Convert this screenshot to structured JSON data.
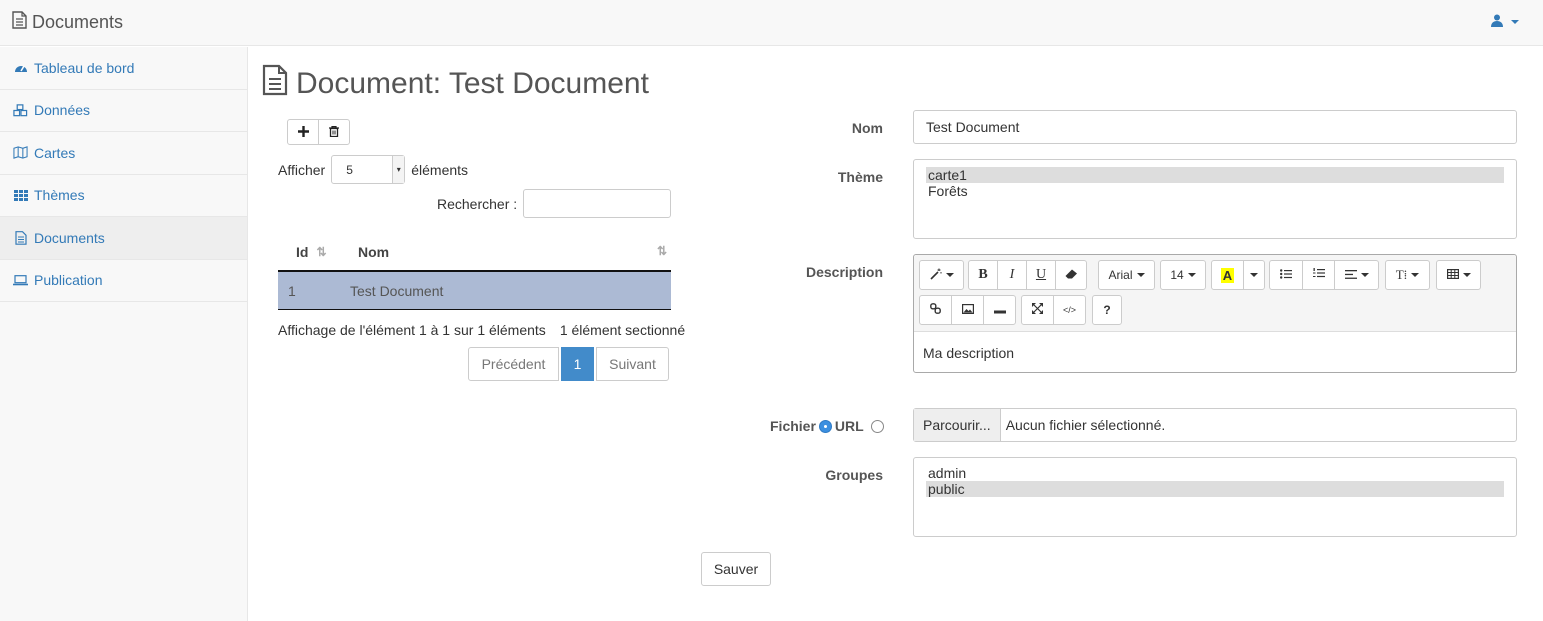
{
  "app": {
    "title": "Documents"
  },
  "sidebar": {
    "items": [
      {
        "label": "Tableau de bord",
        "icon": "dashboard-icon"
      },
      {
        "label": "Données",
        "icon": "cubes-icon"
      },
      {
        "label": "Cartes",
        "icon": "map-icon"
      },
      {
        "label": "Thèmes",
        "icon": "grid-icon"
      },
      {
        "label": "Documents",
        "icon": "document-icon",
        "active": true
      },
      {
        "label": "Publication",
        "icon": "laptop-icon"
      }
    ]
  },
  "page": {
    "title": "Document: Test Document"
  },
  "table": {
    "length_prefix": "Afficher",
    "length_value": "5",
    "length_suffix": "éléments",
    "search_label": "Rechercher :",
    "search_value": "",
    "columns": [
      "Id",
      "Nom"
    ],
    "rows": [
      {
        "id": "1",
        "nom": "Test Document"
      }
    ],
    "info": "Affichage de l'élément 1 à 1 sur 1 éléments",
    "selected_info": "1 élément sectionné",
    "pager": {
      "prev": "Précédent",
      "current": "1",
      "next": "Suivant"
    }
  },
  "form": {
    "nom_label": "Nom",
    "nom_value": "Test Document",
    "theme_label": "Thème",
    "theme_options": [
      {
        "label": "carte1",
        "selected": true
      },
      {
        "label": "Forêts",
        "selected": false
      }
    ],
    "description_label": "Description",
    "editor": {
      "font_name": "Arial",
      "font_size": "14",
      "content": "Ma description"
    },
    "fichier_label": "Fichier",
    "url_label": "URL",
    "file_button": "Parcourir...",
    "file_status": "Aucun fichier sélectionné.",
    "groupes_label": "Groupes",
    "groupes_options": [
      {
        "label": "admin",
        "selected": false
      },
      {
        "label": "public",
        "selected": true
      }
    ],
    "save_label": "Sauver"
  },
  "colors": {
    "link": "#337ab7",
    "selected_row": "#acbad4",
    "primary": "#428bca"
  }
}
